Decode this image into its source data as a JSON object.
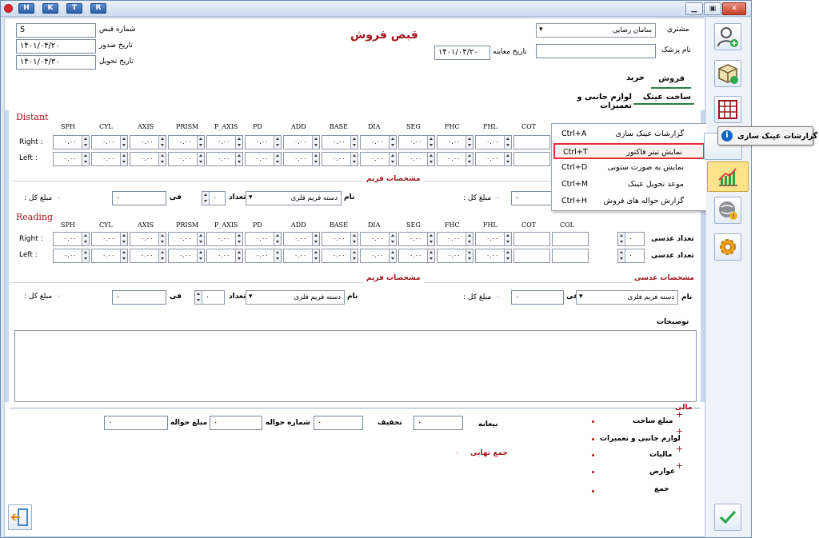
{
  "title_keys": [
    "H",
    "K",
    "T",
    "R"
  ],
  "form_title": "قبض فروش",
  "header": {
    "receipt_no_label": "شماره قبض",
    "receipt_no_value": "5",
    "issue_date_label": "تاریخ صدور",
    "issue_date_value": "۱۴۰۱/۰۴/۲۰",
    "delivery_date_label": "تاریخ تحویل",
    "delivery_date_value": "۱۴۰۱/۰۴/۳۰",
    "customer_label": "مشتری",
    "customer_value": "سامان رضایی",
    "doctor_label": "نام پزشک",
    "doctor_value": "",
    "exam_date_label": "تاریخ معاینه",
    "exam_date_value": "۱۴۰۱/۰۴/۲۰"
  },
  "tabs": {
    "sale": "فروش",
    "purchase": "خرید",
    "lens_making": "ساخت عینک",
    "accessories": "لوازم جانبی و تعمیرات"
  },
  "menu": [
    {
      "label": "گزارشات عینک سازی",
      "shortcut": "Ctrl+A"
    },
    {
      "label": "نمایش تیتر فاکتور",
      "shortcut": "Ctrl+T"
    },
    {
      "label": "نمایش به صورت ستونی",
      "shortcut": "Ctrl+D"
    },
    {
      "label": "موعد تحویل عینک",
      "shortcut": "Ctrl+M"
    },
    {
      "label": "گزارش حواله های فروش",
      "shortcut": "Ctrl+H"
    }
  ],
  "tooltip": "گزارشات عینک سازی",
  "distant": {
    "title": "Distant",
    "right_label": "Right",
    "left_label": "Left"
  },
  "reading": {
    "title": "Reading",
    "right_label": "Right",
    "left_label": "Left"
  },
  "columns": [
    "SPH",
    "CYL",
    "AXIS",
    "PRISM",
    "P_AXIS",
    "PD",
    "ADD",
    "BASE",
    "DIA",
    "SEG",
    "FHC",
    "FHL",
    "COT",
    "COL"
  ],
  "cell_value": "۰.۰۰",
  "frame_spec": {
    "title": "مشخصات فریم",
    "name_label": "نام",
    "name_value": "دسته فریم فلزی",
    "count_label": "تعداد",
    "count_value": "۰",
    "price_label": "فی",
    "price_value": "۰",
    "total_label": "مبلغ کل :",
    "total_value": "۰"
  },
  "lens_spec": {
    "title": "مشخصات عدسی",
    "name_label": "نام",
    "name_value": "دسته فریم فلزی",
    "price_label": "فی",
    "price_value": "۰",
    "total_label": "مبلغ کل :",
    "total_value": "۰",
    "lens_count_label": "تعداد عدسی",
    "lens_count_value": "۰"
  },
  "notes_label": "توضیحات",
  "footer": {
    "deposit_label": "بیعانه",
    "deposit_value": "۰",
    "discount_label": "تخفیف",
    "discount_value": "۰",
    "transfer_no_label": "شماره حواله",
    "transfer_no_value": "۰",
    "transfer_amount_label": "مبلغ حواله",
    "transfer_amount_value": "۰",
    "grand_total_label": "جمع نهایی",
    "grand_total_value": "۰",
    "finance_title": "مالی",
    "lens_making_amount": "مبلغ ساخت",
    "accessories": "لوازم جانبی و تعمیرات",
    "taxes": "مالیات",
    "duties": "عوارض",
    "sum": "جمع"
  }
}
